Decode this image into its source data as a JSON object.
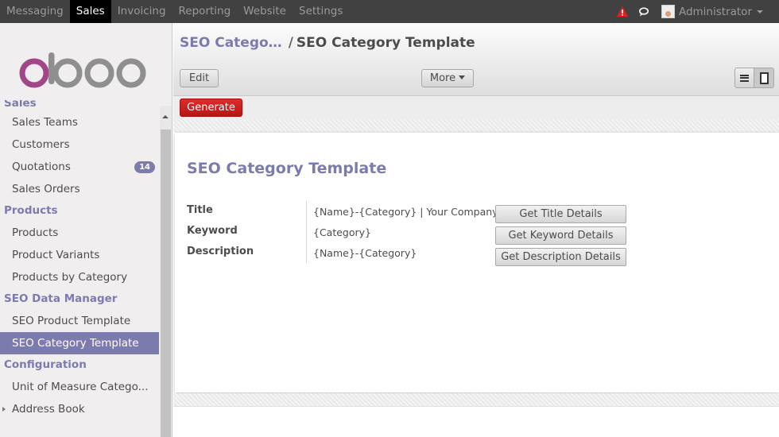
{
  "topbar": {
    "menu": [
      {
        "label": "Messaging",
        "active": false
      },
      {
        "label": "Sales",
        "active": true
      },
      {
        "label": "Invoicing",
        "active": false
      },
      {
        "label": "Reporting",
        "active": false
      },
      {
        "label": "Website",
        "active": false
      },
      {
        "label": "Settings",
        "active": false
      }
    ],
    "user": "Administrator",
    "alert_icon": "alert-triangle-icon",
    "chat_icon": "chat-icon"
  },
  "sidebar": {
    "logo_text": "odoo",
    "cut_section": "Sales",
    "sales_items": [
      {
        "label": "Sales Teams"
      },
      {
        "label": "Customers"
      },
      {
        "label": "Quotations",
        "badge": "14"
      },
      {
        "label": "Sales Orders"
      }
    ],
    "products_header": "Products",
    "products_items": [
      {
        "label": "Products"
      },
      {
        "label": "Product Variants"
      },
      {
        "label": "Products by Category"
      }
    ],
    "seo_header": "SEO Data Manager",
    "seo_items": [
      {
        "label": "SEO Product Template",
        "active": false
      },
      {
        "label": "SEO Category Template",
        "active": true
      }
    ],
    "config_header": "Configuration",
    "config_items": [
      {
        "label": "Unit of Measure Catego..."
      },
      {
        "label": "Address Book"
      }
    ]
  },
  "control": {
    "breadcrumb_parent": "SEO Catego…",
    "breadcrumb_sep": "/",
    "breadcrumb_current": "SEO Category Template",
    "edit_label": "Edit",
    "more_label": "More"
  },
  "actions": {
    "generate_label": "Generate"
  },
  "form": {
    "title": "SEO Category Template",
    "fields": [
      {
        "label": "Title",
        "value": "{Name}-{Category} | Your Company",
        "button": "Get Title Details"
      },
      {
        "label": "Keyword",
        "value": "{Category}",
        "button": "Get Keyword Details"
      },
      {
        "label": "Description",
        "value": "{Name}-{Category}",
        "button": "Get Description Details"
      }
    ]
  },
  "colors": {
    "accent": "#7c7bad",
    "topbar": "#414141",
    "generate": "#d22020",
    "logo_purple": "#a24689",
    "logo_grey": "#8f8f8f"
  }
}
